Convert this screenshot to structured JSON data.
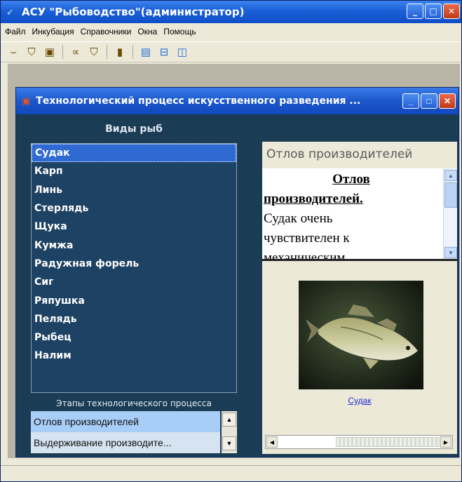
{
  "window": {
    "title": "АСУ \"Рыбоводство\"(администратор)",
    "icon": "app-arrow-icon"
  },
  "menu": [
    "Файл",
    "Инкубация",
    "Справочники",
    "Окна",
    "Помощь"
  ],
  "child_window": {
    "title": "Технологический процесс искусственного разведения ..."
  },
  "fish_panel": {
    "header": "Виды рыб",
    "items": [
      "Судак",
      "Карп",
      "Линь",
      "Стерлядь",
      "Щука",
      "Кумжа",
      "Радужная форель",
      "Сиг",
      "Ряпушка",
      "Пелядь",
      "Рыбец",
      "Налим"
    ],
    "selected": "Судак"
  },
  "stages_panel": {
    "header": "Этапы технологического процесса",
    "items": [
      "Отлов производителей",
      "Выдерживание производите..."
    ]
  },
  "detail_panel": {
    "title": "Отлов производителей",
    "heading_line1": "Отлов",
    "heading_line2": "производителей.",
    "text_lines": [
      "Судак очень",
      "чувствителен к",
      "механическим"
    ],
    "image_caption": "Судак"
  },
  "colors": {
    "titlebar": "#1b5fd6",
    "child_background": "#1b3c55",
    "selection": "#2f6ad3",
    "stage_selected": "#a8cdf6",
    "link": "#1f2bd6"
  }
}
